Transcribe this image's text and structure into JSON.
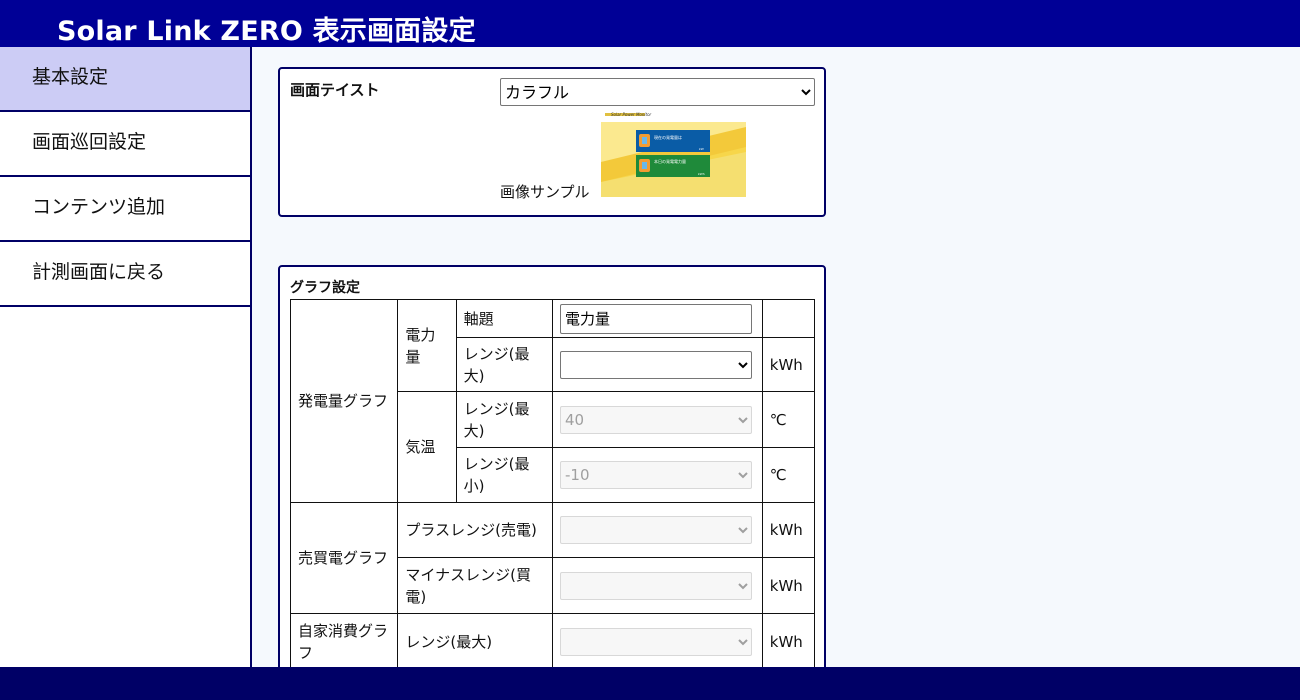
{
  "header": {
    "title": "Solar Link ZERO 表示画面設定"
  },
  "sidebar": {
    "items": [
      {
        "label": "基本設定"
      },
      {
        "label": "画面巡回設定"
      },
      {
        "label": "コンテンツ追加"
      },
      {
        "label": "計測画面に戻る"
      }
    ]
  },
  "theme_panel": {
    "label": "画面テイスト",
    "selected": "カラフル",
    "sample_label": "画像サンプル",
    "sample": {
      "brand": "Solar Power Monitor",
      "card1": "現在の発電量は",
      "card1_unit": "kW",
      "card2": "本日の発電電力量",
      "card2_unit": "kWh"
    }
  },
  "graph_panel": {
    "label": "グラフ設定",
    "gen_graph": "発電量グラフ",
    "power": "電力量",
    "axis_title": "軸題",
    "axis_value": "電力量",
    "range_max": "レンジ(最大)",
    "range_min": "レンジ(最小)",
    "temp": "気温",
    "temp_max_value": "40",
    "temp_min_value": "-10",
    "trade_graph": "売買電グラフ",
    "plus_range": "プラスレンジ(売電)",
    "minus_range": "マイナスレンジ(買電)",
    "self_graph": "自家消費グラフ",
    "unit_kwh": "kWh",
    "unit_c": "℃"
  }
}
